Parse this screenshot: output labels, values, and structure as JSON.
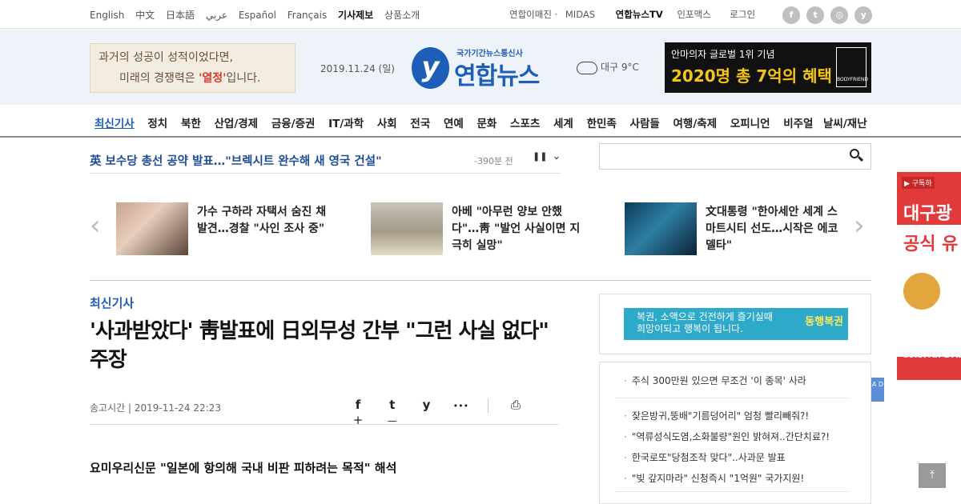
{
  "languages": [
    "English",
    "中文",
    "日本語",
    "عربي",
    "Español",
    "Français"
  ],
  "util_links": [
    "기사제보",
    "상품소개"
  ],
  "top_links": [
    "연합이매진 ·",
    "MIDAS",
    "연합뉴스TV",
    "인포맥스",
    "로그인"
  ],
  "social": [
    {
      "icon": "facebook-icon",
      "glyph": "f"
    },
    {
      "icon": "twitter-icon",
      "glyph": "t"
    },
    {
      "icon": "instagram-icon",
      "glyph": "◎"
    },
    {
      "icon": "yna-icon",
      "glyph": "y"
    }
  ],
  "header": {
    "banner_left_line1": "과거의 성공이 성적이었다면,",
    "banner_left_line2a": "미래의 경쟁력은 ",
    "banner_left_line2b": "'열정'",
    "banner_left_line2c": "입니다.",
    "date": "2019.11.24 (일)",
    "logo_sub": "국가기간뉴스통신사",
    "logo_main": "연합뉴스",
    "logo_letter": "y",
    "weather": "대구 9°C",
    "banner_right_line1": "안마의자 글로벌 1위 기념",
    "banner_right_line2": "2020명 총 7억의 혜택",
    "banner_right_brand": "BODYFRIEND"
  },
  "nav": [
    "최신기사",
    "정치",
    "북한",
    "산업/경제",
    "금융/증권",
    "IT/과학",
    "사회",
    "전국",
    "연예",
    "문화",
    "스포츠",
    "세계",
    "한민족",
    "사람들",
    "여행/축제",
    "오피니언",
    "비주얼"
  ],
  "nav_extra": "날씨/재난",
  "ticker": {
    "text": "英 보수당 총선 공약 발표…\"브렉시트 완수해 새 영국 건설\"",
    "time": "-390분 전",
    "pause": "❚❚",
    "next": "⌄"
  },
  "carousel": [
    {
      "title": "가수 구하라 자택서 숨진 채 발견…경찰 \"사인 조사 중\""
    },
    {
      "title": "아베 \"아무런 양보 안했다\"…靑 \"발언 사실이면 지극히 실망\""
    },
    {
      "title": "文대통령 \"한아세안 세계 스마트시티 선도…시작은 에코델타\""
    }
  ],
  "carousel_prev": "‹",
  "carousel_next": "›",
  "article": {
    "section": "최신기사",
    "headline": "'사과받았다' 靑발표에 日외무성 간부 \"그런 사실 없다\" 주장",
    "time": "송고시간 | 2019-11-24 22:23",
    "subhead": "요미우리신문 \"일본에 항의해 국내 비판 피하려는 목적\" 해석"
  },
  "share": [
    {
      "icon": "facebook-icon",
      "glyph": "f"
    },
    {
      "icon": "twitter-icon",
      "glyph": "t"
    },
    {
      "icon": "yna-icon",
      "glyph": "y"
    },
    {
      "icon": "more-icon",
      "glyph": "•••"
    },
    {
      "icon": "print-icon",
      "glyph": "⎙"
    },
    {
      "icon": "zoom-in-icon",
      "glyph": "+"
    },
    {
      "icon": "zoom-out-icon",
      "glyph": "—"
    }
  ],
  "side_ad": {
    "line1": "복권, 소액으로 건전하게 즐기실때",
    "line2": "희망이되고 행복이 됩니다.",
    "logo": "동행복권"
  },
  "side_list": [
    "주식 300만원 있으면 무조건 '이 종목' 사라",
    "잦은방귀,뚱배\"기름덩어리\" 엄청 빨리빼줘?!",
    "\"역류성식도염,소화불량\"원인 밝혀져..간단치료?!",
    "한국로또\"당첨조작 맞다\"..사과문 발표",
    "\"빚 갚지마라\" 신청즉시 \"1억원\" 국가지원!"
  ],
  "float_ad": {
    "subscribe": "▶ 구독하",
    "title": "대구광",
    "subtitle": "공식 유",
    "brand": "Colorful DAE"
  },
  "ad_tag": "A D",
  "to_top": "⤒"
}
